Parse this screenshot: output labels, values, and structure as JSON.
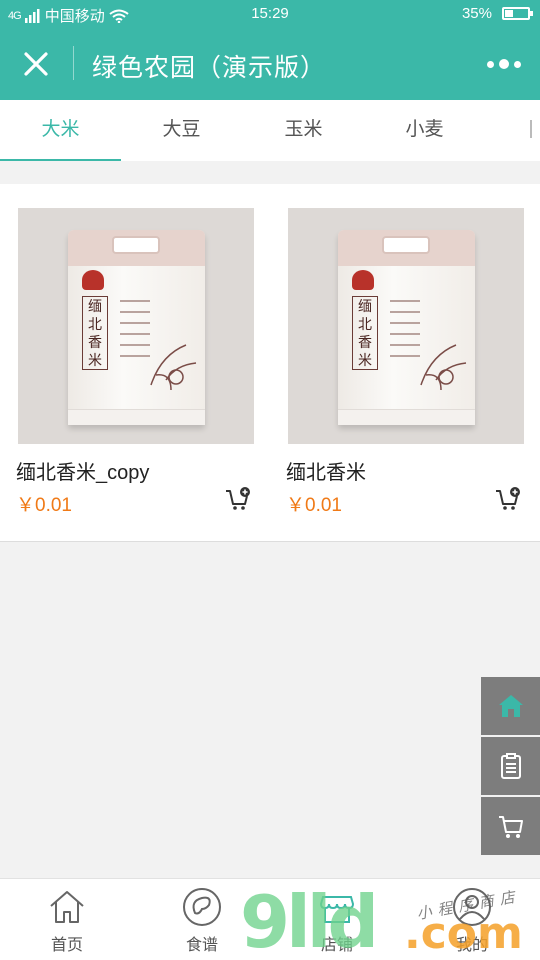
{
  "status_bar": {
    "signal": "4G",
    "carrier": "中国移动",
    "time": "15:29",
    "battery": "35%",
    "battery_level": 0.35
  },
  "header": {
    "title": "绿色农园（演示版）",
    "close_icon": "close-icon",
    "more_icon": "more-dots-icon"
  },
  "tabs": [
    {
      "label": "大米",
      "active": true
    },
    {
      "label": "大豆",
      "active": false
    },
    {
      "label": "玉米",
      "active": false
    },
    {
      "label": "小麦",
      "active": false
    }
  ],
  "products": [
    {
      "name": "缅北香米_copy",
      "price": "￥0.01",
      "bag_text": "缅北香米"
    },
    {
      "name": "缅北香米",
      "price": "￥0.01",
      "bag_text": "缅北香米"
    }
  ],
  "side_buttons": [
    {
      "icon": "home-icon"
    },
    {
      "icon": "clipboard-icon"
    },
    {
      "icon": "cart-icon"
    }
  ],
  "bottom_nav": [
    {
      "label": "首页",
      "icon": "house-icon"
    },
    {
      "label": "食谱",
      "icon": "bean-icon"
    },
    {
      "label": "店铺",
      "icon": "store-icon"
    },
    {
      "label": "我的",
      "icon": "user-icon"
    }
  ],
  "watermark": {
    "text_main": "9lld",
    "text_domain": ".com",
    "text_script": "小程序商店"
  },
  "colors": {
    "accent": "#3bb8a8",
    "price": "#f07a17",
    "side_button": "#7d7d7d"
  }
}
